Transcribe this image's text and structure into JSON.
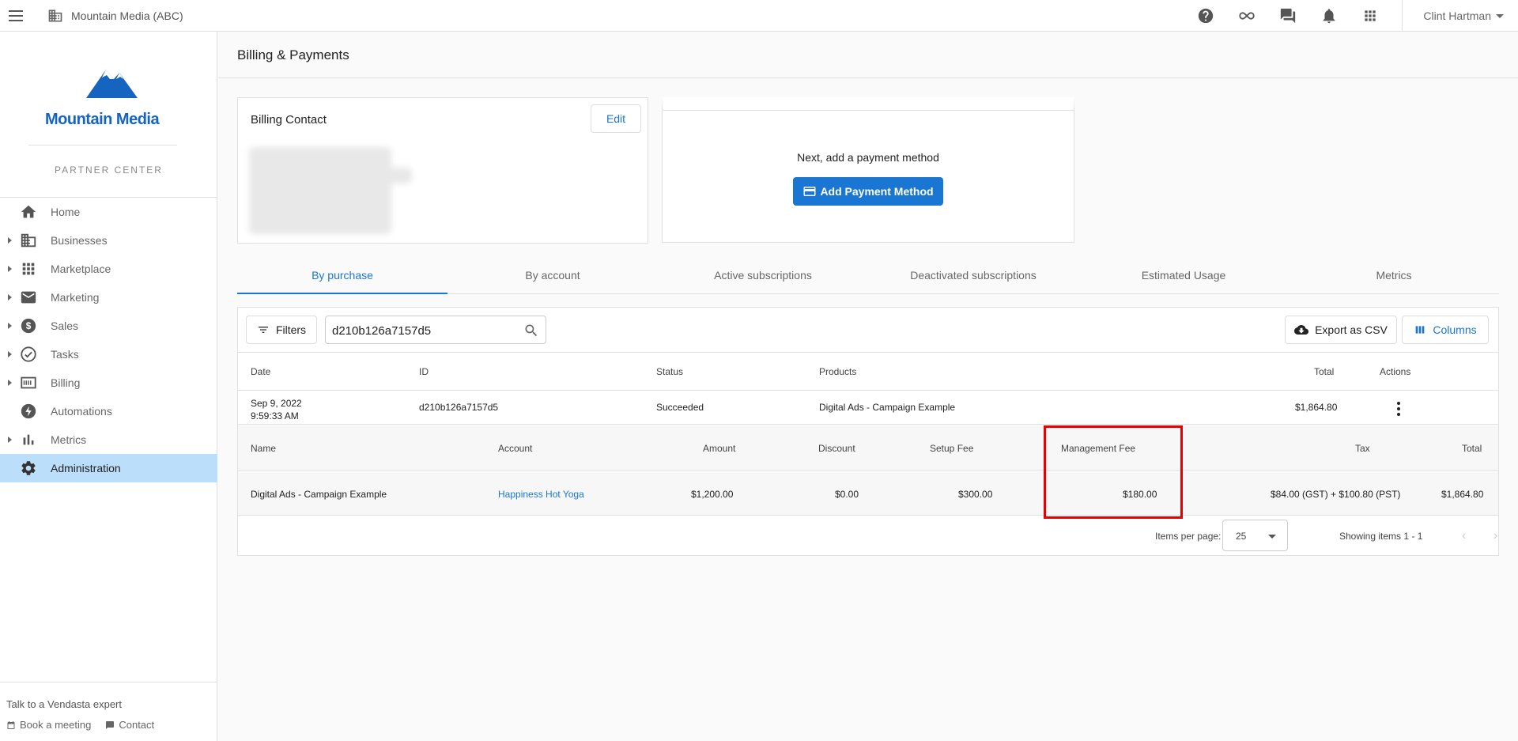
{
  "topbar": {
    "org_name": "Mountain Media (ABC)",
    "user_name": "Clint Hartman",
    "icons": [
      "help-icon",
      "infinity-icon",
      "chat-icon",
      "notifications-icon",
      "apps-grid-icon"
    ]
  },
  "sidebar": {
    "logo_text": "Mountain Media",
    "partner_center": "PARTNER CENTER",
    "items": [
      {
        "label": "Home",
        "icon": "home-icon",
        "expandable": false
      },
      {
        "label": "Businesses",
        "icon": "business-icon",
        "expandable": true
      },
      {
        "label": "Marketplace",
        "icon": "grid-icon",
        "expandable": true
      },
      {
        "label": "Marketing",
        "icon": "mail-icon",
        "expandable": true
      },
      {
        "label": "Sales",
        "icon": "dollar-icon",
        "expandable": true
      },
      {
        "label": "Tasks",
        "icon": "check-circle-icon",
        "expandable": true
      },
      {
        "label": "Billing",
        "icon": "billing-icon",
        "expandable": true
      },
      {
        "label": "Automations",
        "icon": "bolt-icon",
        "expandable": false
      },
      {
        "label": "Metrics",
        "icon": "bar-chart-icon",
        "expandable": true
      },
      {
        "label": "Administration",
        "icon": "gear-icon",
        "expandable": false,
        "active": true
      }
    ],
    "footer": {
      "talk": "Talk to a Vendasta expert",
      "book": "Book a meeting",
      "contact": "Contact"
    }
  },
  "page": {
    "title": "Billing & Payments"
  },
  "billing_contact": {
    "title": "Billing Contact",
    "edit_label": "Edit"
  },
  "payment": {
    "prompt": "Next, add a payment method",
    "button_label": "Add Payment Method"
  },
  "tabs": [
    {
      "label": "By purchase",
      "active": true
    },
    {
      "label": "By account"
    },
    {
      "label": "Active subscriptions"
    },
    {
      "label": "Deactivated subscriptions"
    },
    {
      "label": "Estimated Usage"
    },
    {
      "label": "Metrics"
    }
  ],
  "toolbar": {
    "filters_label": "Filters",
    "search_value": "d210b126a7157d5",
    "export_label": "Export as CSV",
    "columns_label": "Columns"
  },
  "table": {
    "headers": {
      "date": "Date",
      "id": "ID",
      "status": "Status",
      "products": "Products",
      "total": "Total",
      "actions": "Actions"
    },
    "row": {
      "date": "Sep 9, 2022",
      "time": "9:59:33 AM",
      "id": "d210b126a7157d5",
      "status": "Succeeded",
      "products": "Digital Ads - Campaign Example",
      "total": "$1,864.80"
    },
    "sub_headers": {
      "name": "Name",
      "account": "Account",
      "amount": "Amount",
      "discount": "Discount",
      "setup_fee": "Setup Fee",
      "management_fee": "Management Fee",
      "tax": "Tax",
      "total": "Total"
    },
    "sub_row": {
      "name": "Digital Ads - Campaign Example",
      "account": "Happiness Hot Yoga",
      "amount": "$1,200.00",
      "discount": "$0.00",
      "setup_fee": "$300.00",
      "management_fee": "$180.00",
      "tax": "$84.00 (GST) + $100.80 (PST)",
      "total": "$1,864.80"
    }
  },
  "pager": {
    "items_per_page_label": "Items per page:",
    "items_per_page": "25",
    "showing": "Showing items 1 - 1"
  },
  "colors": {
    "accent": "#1976d2",
    "active_nav": "#bbdefb",
    "highlight": "#e60000"
  }
}
